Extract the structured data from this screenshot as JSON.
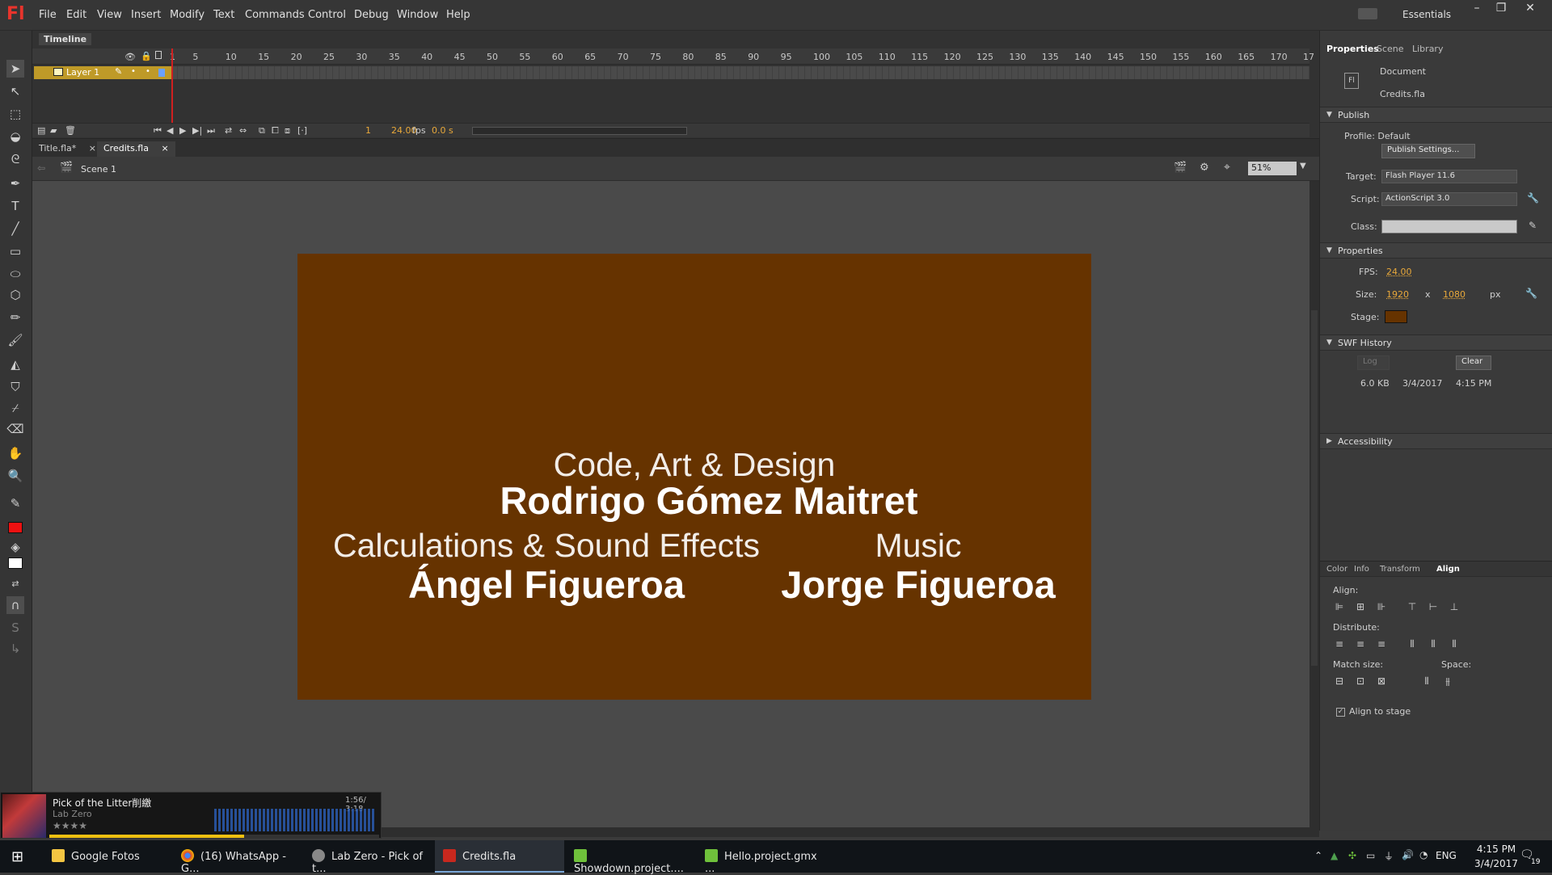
{
  "app": {
    "logo": "Fl"
  },
  "menu": [
    "File",
    "Edit",
    "View",
    "Insert",
    "Modify",
    "Text",
    "Commands",
    "Control",
    "Debug",
    "Window",
    "Help"
  ],
  "workspace": {
    "label": "Essentials"
  },
  "timeline": {
    "tab_label": "Timeline",
    "ruler": [
      "1",
      "5",
      "10",
      "15",
      "20",
      "25",
      "30",
      "35",
      "40",
      "45",
      "50",
      "55",
      "60",
      "65",
      "70",
      "75",
      "80",
      "85",
      "90",
      "95",
      "100",
      "105",
      "110",
      "115",
      "120",
      "125",
      "130",
      "135",
      "140",
      "145",
      "150",
      "155",
      "160",
      "165",
      "170",
      "17"
    ],
    "layer_name": "Layer 1",
    "current_frame": "1",
    "fps": "24.00",
    "fps_unit": "fps",
    "time": "0.0 s"
  },
  "doc_tabs": [
    {
      "label": "Title.fla*",
      "close": "×"
    },
    {
      "label": "Credits.fla",
      "close": "×"
    }
  ],
  "scene": {
    "label": "Scene 1",
    "zoom": "51%"
  },
  "stage": {
    "color": "#663300",
    "line1": "Code, Art & Design",
    "name1": "Rodrigo Gómez Maitret",
    "line2": "Calculations & Sound Effects",
    "name2": "Ángel Figueroa",
    "line3": "Music",
    "name3": "Jorge Figueroa"
  },
  "properties_panel": {
    "tabs": [
      "Properties",
      "Scene",
      "Library"
    ],
    "doc_type": "Document",
    "doc_name": "Credits.fla",
    "publish": {
      "header": "Publish",
      "profile": "Profile: Default",
      "settings_button": "Publish Settings...",
      "target_label": "Target:",
      "target_value": "Flash Player 11.6",
      "script_label": "Script:",
      "script_value": "ActionScript 3.0",
      "class_label": "Class:"
    },
    "properties": {
      "header": "Properties",
      "fps_label": "FPS:",
      "fps_value": "24.00",
      "size_label": "Size:",
      "width": "1920",
      "x": "x",
      "height": "1080",
      "unit": "px",
      "stage_label": "Stage:",
      "stage_color": "#663300"
    },
    "swf_history": {
      "header": "SWF History",
      "log_button": "Log",
      "clear_button": "Clear",
      "size": "6.0 KB",
      "date": "3/4/2017",
      "time": "4:15 PM"
    },
    "accessibility": {
      "header": "Accessibility"
    }
  },
  "align_panel": {
    "tabs": [
      "Color",
      "Info",
      "Transform",
      "Align"
    ],
    "align_label": "Align:",
    "distribute_label": "Distribute:",
    "match_size_label": "Match size:",
    "space_label": "Space:",
    "align_to_stage": "Align to stage"
  },
  "music_player": {
    "title": "Pick of the Litter削繳",
    "artist": "Lab Zero",
    "time": "1:56/ 3:18",
    "rating": "★★★★",
    "progress": 0.59
  },
  "taskbar": {
    "items": [
      {
        "label": "Google Fotos"
      },
      {
        "label": "(16) WhatsApp - G..."
      },
      {
        "label": "Lab Zero - Pick of t..."
      },
      {
        "label": "Credits.fla"
      },
      {
        "label": "Showdown.project...."
      },
      {
        "label": "Hello.project.gmx ..."
      }
    ],
    "language": "ENG",
    "clock_time": "4:15 PM",
    "clock_date": "3/4/2017",
    "notifications": "19"
  }
}
